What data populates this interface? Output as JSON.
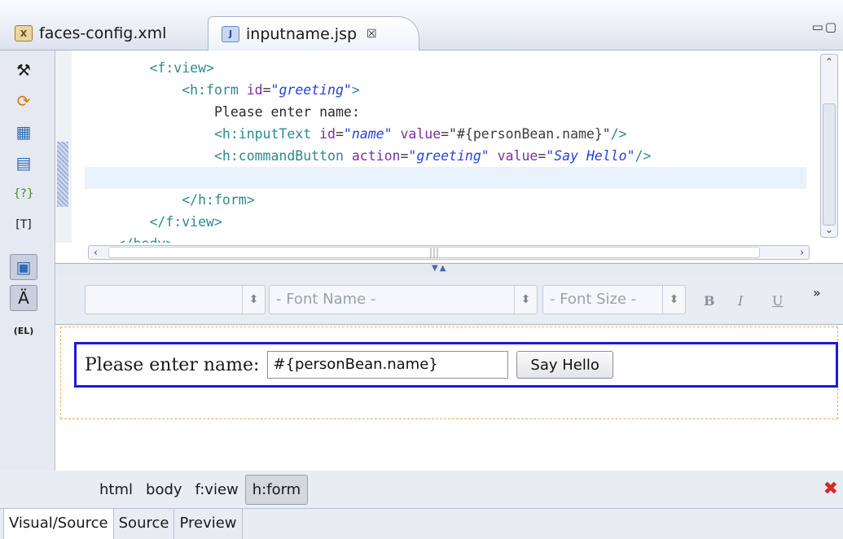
{
  "tabs": [
    {
      "label": "faces-config.xml",
      "icon": "xml-file-icon",
      "active": false
    },
    {
      "label": "inputname.jsp",
      "icon": "jsp-file-icon",
      "active": true,
      "close": "☒"
    }
  ],
  "source_lines": [
    {
      "indent": "        ",
      "parts": [
        [
          "tag",
          "<f:view>"
        ]
      ]
    },
    {
      "indent": "            ",
      "parts": [
        [
          "tag",
          "<h:form "
        ],
        [
          "attr",
          "id"
        ],
        [
          "str",
          "="
        ],
        [
          "val",
          "\"greeting\""
        ],
        [
          "tag",
          ">"
        ]
      ]
    },
    {
      "indent": "                ",
      "parts": [
        [
          "plain",
          "Please enter name:"
        ]
      ]
    },
    {
      "indent": "                ",
      "parts": [
        [
          "tag",
          "<h:inputText "
        ],
        [
          "attr",
          "id"
        ],
        [
          "str",
          "="
        ],
        [
          "val",
          "\"name\""
        ],
        [
          "plain",
          " "
        ],
        [
          "attr",
          "value"
        ],
        [
          "str",
          "=\"#{personBean.name}\""
        ],
        [
          "tag",
          "/>"
        ]
      ]
    },
    {
      "indent": "                ",
      "parts": [
        [
          "tag",
          "<h:commandButton "
        ],
        [
          "attr",
          "action"
        ],
        [
          "str",
          "="
        ],
        [
          "val",
          "\"greeting\""
        ],
        [
          "plain",
          " "
        ],
        [
          "attr",
          "value"
        ],
        [
          "str",
          "="
        ],
        [
          "val",
          "\"Say Hello\""
        ],
        [
          "tag",
          "/>"
        ]
      ]
    },
    {
      "indent": "",
      "parts": [],
      "current": true
    },
    {
      "indent": "            ",
      "parts": [
        [
          "tag",
          "</h:form>"
        ]
      ]
    },
    {
      "indent": "        ",
      "parts": [
        [
          "tag",
          "</f:view>"
        ]
      ]
    },
    {
      "indent": "    ",
      "parts": [
        [
          "tag",
          "</body>"
        ]
      ]
    }
  ],
  "format_toolbar": {
    "font_name": "- Font Name -",
    "font_size": "- Font Size -",
    "bold": "B",
    "italic": "I",
    "underline": "U",
    "overflow": "»"
  },
  "visual": {
    "prompt_text": "Please enter name:",
    "input_value": "#{personBean.name}",
    "button_label": "Say Hello"
  },
  "breadcrumb": [
    "html",
    "body",
    "f:view",
    "h:form"
  ],
  "bottom_tabs": [
    "Visual/Source",
    "Source",
    "Preview"
  ],
  "palette_icons": [
    "jsf-tools-icon",
    "refresh-icon",
    "jsf-html-icon",
    "jsf-core-icon",
    "unknown-tag-icon",
    "text-tag-icon",
    "insert-tag-icon",
    "style-icon",
    "el-icon"
  ]
}
